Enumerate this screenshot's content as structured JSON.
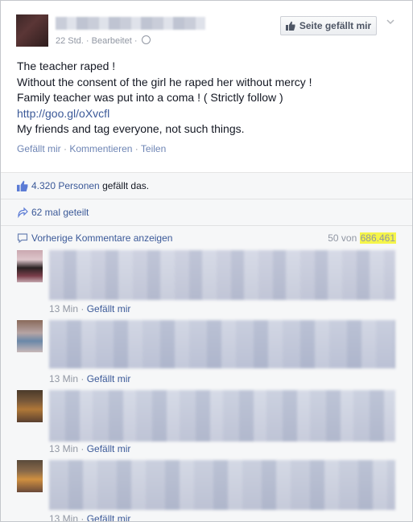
{
  "post": {
    "time": "22 Std.",
    "edited": "Bearbeitet",
    "like_page_label": "Seite gefällt mir",
    "lines": [
      "The teacher raped !",
      "Without the consent of the girl he raped her without mercy !",
      "Family teacher was put into a coma ! ( Strictly follow )"
    ],
    "link": "http://goo.gl/oXvcfl",
    "last_line": "My friends and tag everyone, not such things.",
    "actions": {
      "like": "Gefällt mir",
      "comment": "Kommentieren",
      "share": "Teilen"
    }
  },
  "stats": {
    "likes_count": "4.320 Personen",
    "likes_suffix": "gefällt das.",
    "shares": "62 mal geteilt"
  },
  "comments_header": {
    "previous_label": "Vorherige Kommentare anzeigen",
    "shown_prefix": "50 von",
    "total": "686.461"
  },
  "comments": [
    {
      "time": "13 Min",
      "like": "Gefällt mir"
    },
    {
      "time": "13 Min",
      "like": "Gefällt mir"
    },
    {
      "time": "13 Min",
      "like": "Gefällt mir"
    },
    {
      "time": "13 Min",
      "like": "Gefällt mir"
    }
  ],
  "colors": {
    "link": "#3b5998",
    "highlight": "#f5f54a",
    "meta": "#9197a3"
  }
}
